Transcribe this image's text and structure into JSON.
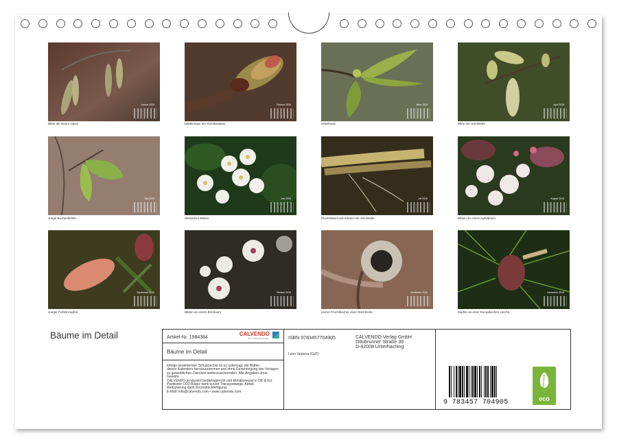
{
  "title": "Bäume im Detail",
  "months": [
    {
      "name": "Januar 2026",
      "caption": "Blüte der Baum-Hasel"
    },
    {
      "name": "Februar 2026",
      "caption": "Blattknospe der Rosskastanie"
    },
    {
      "name": "März 2026",
      "caption": "Haselnuss"
    },
    {
      "name": "April 2026",
      "caption": "Blüte der Sal-Weide"
    },
    {
      "name": "Mai 2026",
      "caption": "Junge Buchenblätter"
    },
    {
      "name": "Juni 2026",
      "caption": "Weissdorn-Blüten"
    },
    {
      "name": "Juli 2026",
      "caption": "Fruchtstand und Samen der Sal-Weide"
    },
    {
      "name": "August 2026",
      "caption": "Blüten an einem Apfelbaum"
    },
    {
      "name": "September 2026",
      "caption": "Junger Fichtenzapfen"
    },
    {
      "name": "Oktober 2026",
      "caption": "Blüten an einem Birnbaum"
    },
    {
      "name": "November 2026",
      "caption": "Leerer Fruchtbecher einer Stiel-Eiche"
    },
    {
      "name": "Dezember 2026",
      "caption": "Zapfen an einer Europäischen Lärche"
    }
  ],
  "info": {
    "article": "Artikel-Nr. 1984384",
    "brand": "CALVENDO",
    "brand_sub": "Der Kalenderverlag",
    "calendar_title": "Bäume im Detail",
    "legal": [
      "Infolge bestehender Schutzrechte ist es untersagt, die Blätter",
      "dieses Kalenders herauszutrennen und ohne Genehmigung des Verlages",
      "zu gewerblichen Zwecken weiterzuverwenden. Alle Angaben ohne",
      "Gewähr.",
      "CALVENDO produziert bedarfsgerecht und klimabewusst in DE & EU.",
      "Positivere CO2-Bilanz dank kurzer Transportwege, Abfall-",
      "Reduzierung dank Einzelstückfertigung.",
      "E-Mail: info@calvendo.com • www.calvendo.com"
    ],
    "isbn": "ISBN 9783457704905",
    "author": "Leon Uppena (GdT)",
    "publisher": [
      "CALVENDO Verlag GmbH",
      "Ottobrunner Straße 39",
      "D-82008 Unterhaching"
    ],
    "barcode_digits": "9 783457 704905",
    "eco_label": "eco"
  }
}
